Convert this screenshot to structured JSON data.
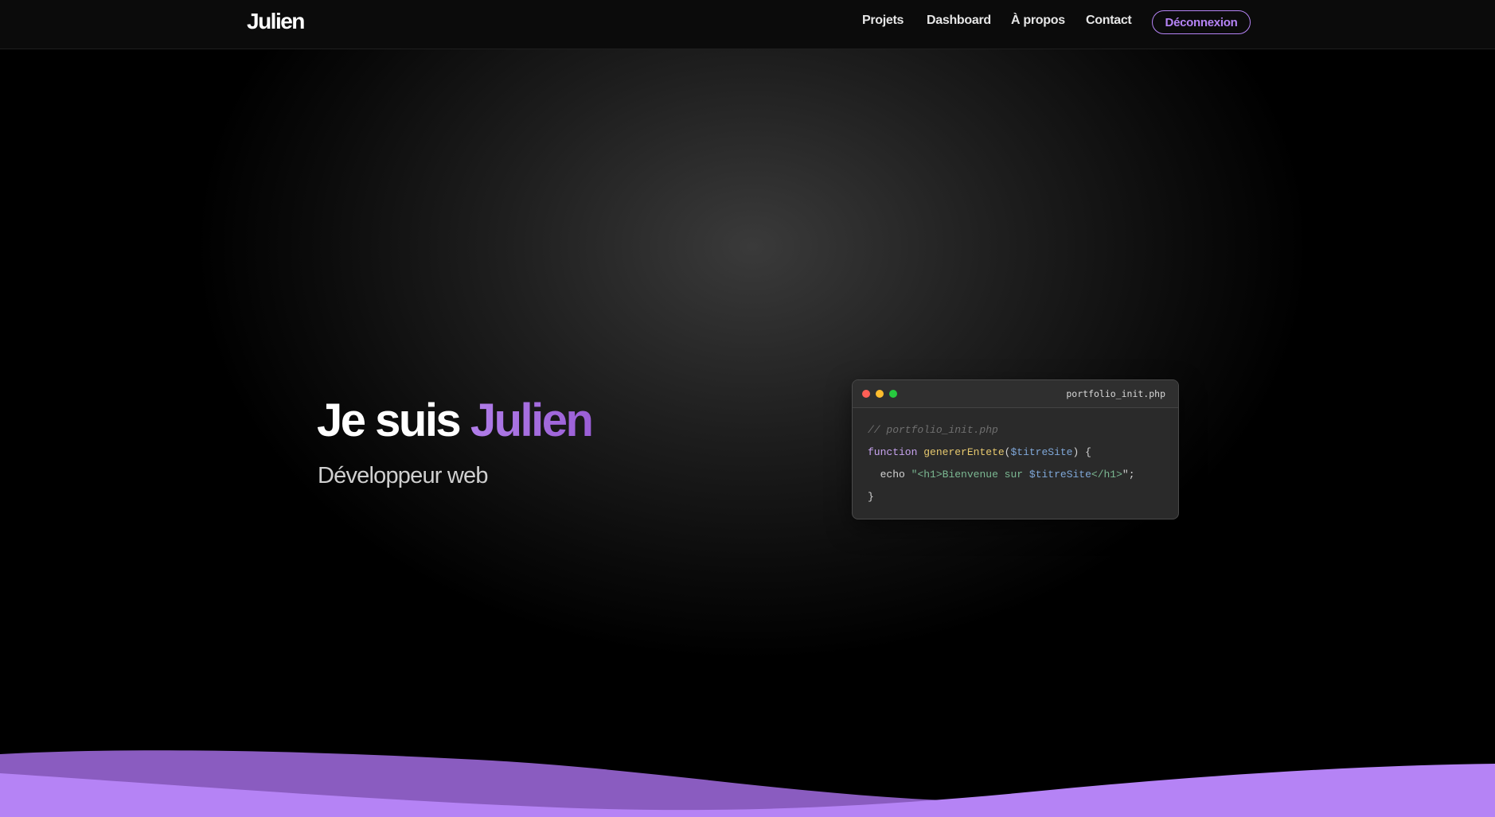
{
  "nav": {
    "logo": "Julien",
    "links": [
      "Projets",
      "Dashboard",
      "À propos",
      "Contact"
    ],
    "logout": "Déconnexion"
  },
  "hero": {
    "title_prefix": "Je suis ",
    "title_accent": "Julien",
    "subtitle": "Développeur web"
  },
  "code": {
    "filename": "portfolio_init.php",
    "comment": "// portfolio_init.php",
    "line2_keyword": "function",
    "line2_func": "genererEntete",
    "line2_open": "(",
    "line2_var": "$titreSite",
    "line2_close": ") {",
    "line3_keyword": "echo",
    "line3_q1": "\"",
    "line3_str": "<h1>Bienvenue sur ",
    "line3_var": "$titreSite",
    "line3_str2": "</h1>",
    "line3_end": "\";",
    "line4": "}"
  },
  "colors": {
    "accent": "#b583f5",
    "wave_back": "#8a5cc0",
    "wave_front": "#b583f5"
  }
}
